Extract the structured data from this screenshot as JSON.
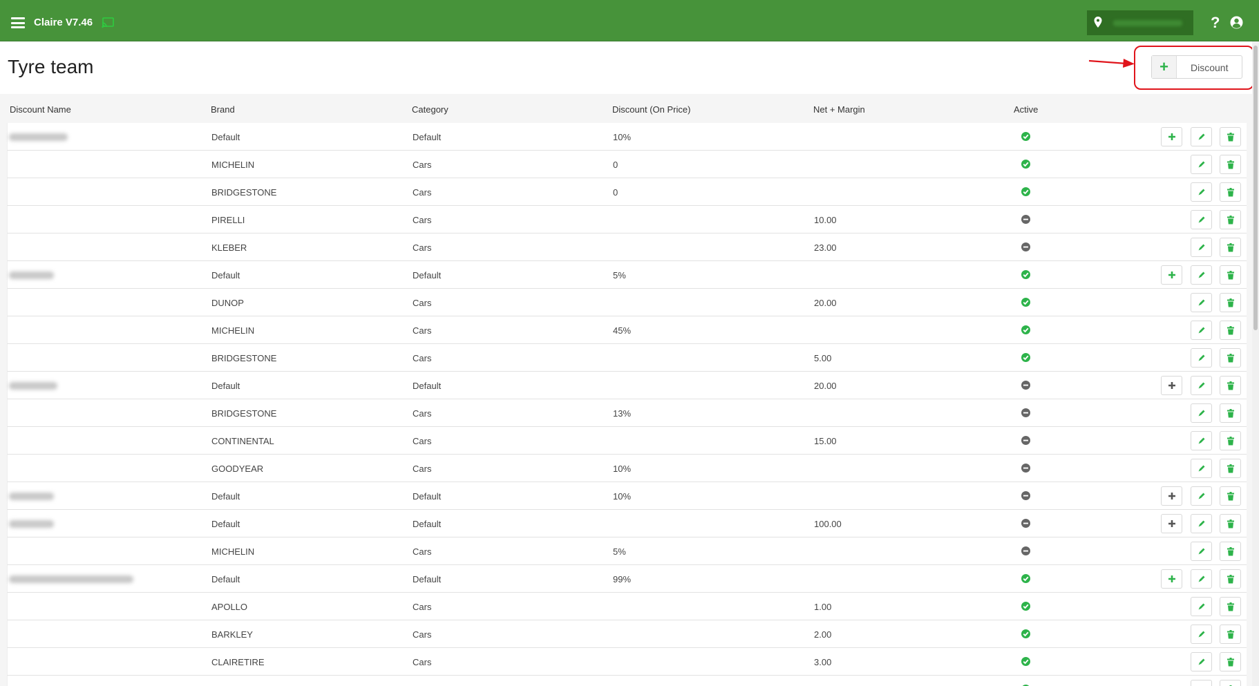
{
  "app": {
    "title": "Claire V7.46"
  },
  "page": {
    "title": "Tyre team",
    "add_button_label": "Discount"
  },
  "columns": [
    "Discount Name",
    "Brand",
    "Category",
    "Discount (On Price)",
    "Net + Margin",
    "Active"
  ],
  "colors": {
    "topbar": "#47933a",
    "accent_green": "#2db34a",
    "annotation_red": "#e0141b"
  },
  "rows": [
    {
      "name_blur": 85,
      "brand": "Default",
      "category": "Default",
      "discount": "10%",
      "net": "",
      "active": true,
      "add": "green"
    },
    {
      "name_blur": 0,
      "brand": "MICHELIN",
      "category": "Cars",
      "discount": "0",
      "net": "",
      "active": true,
      "add": ""
    },
    {
      "name_blur": 0,
      "brand": "BRIDGESTONE",
      "category": "Cars",
      "discount": "0",
      "net": "",
      "active": true,
      "add": ""
    },
    {
      "name_blur": 0,
      "brand": "PIRELLI",
      "category": "Cars",
      "discount": "",
      "net": "10.00",
      "active": false,
      "add": ""
    },
    {
      "name_blur": 0,
      "brand": "KLEBER",
      "category": "Cars",
      "discount": "",
      "net": "23.00",
      "active": false,
      "add": ""
    },
    {
      "name_blur": 65,
      "brand": "Default",
      "category": "Default",
      "discount": "5%",
      "net": "",
      "active": true,
      "add": "green"
    },
    {
      "name_blur": 0,
      "brand": "DUNOP",
      "category": "Cars",
      "discount": "",
      "net": "20.00",
      "active": true,
      "add": ""
    },
    {
      "name_blur": 0,
      "brand": "MICHELIN",
      "category": "Cars",
      "discount": "45%",
      "net": "",
      "active": true,
      "add": ""
    },
    {
      "name_blur": 0,
      "brand": "BRIDGESTONE",
      "category": "Cars",
      "discount": "",
      "net": "5.00",
      "active": true,
      "add": ""
    },
    {
      "name_blur": 70,
      "brand": "Default",
      "category": "Default",
      "discount": "",
      "net": "20.00",
      "active": false,
      "add": "gray"
    },
    {
      "name_blur": 0,
      "brand": "BRIDGESTONE",
      "category": "Cars",
      "discount": "13%",
      "net": "",
      "active": false,
      "add": ""
    },
    {
      "name_blur": 0,
      "brand": "CONTINENTAL",
      "category": "Cars",
      "discount": "",
      "net": "15.00",
      "active": false,
      "add": ""
    },
    {
      "name_blur": 0,
      "brand": "GOODYEAR",
      "category": "Cars",
      "discount": "10%",
      "net": "",
      "active": false,
      "add": ""
    },
    {
      "name_blur": 65,
      "brand": "Default",
      "category": "Default",
      "discount": "10%",
      "net": "",
      "active": false,
      "add": "gray"
    },
    {
      "name_blur": 65,
      "brand": "Default",
      "category": "Default",
      "discount": "",
      "net": "100.00",
      "active": false,
      "add": "gray"
    },
    {
      "name_blur": 0,
      "brand": "MICHELIN",
      "category": "Cars",
      "discount": "5%",
      "net": "",
      "active": false,
      "add": ""
    },
    {
      "name_blur": 180,
      "brand": "Default",
      "category": "Default",
      "discount": "99%",
      "net": "",
      "active": true,
      "add": "green"
    },
    {
      "name_blur": 0,
      "brand": "APOLLO",
      "category": "Cars",
      "discount": "",
      "net": "1.00",
      "active": true,
      "add": ""
    },
    {
      "name_blur": 0,
      "brand": "BARKLEY",
      "category": "Cars",
      "discount": "",
      "net": "2.00",
      "active": true,
      "add": ""
    },
    {
      "name_blur": 0,
      "brand": "CLAIRETIRE",
      "category": "Cars",
      "discount": "",
      "net": "3.00",
      "active": true,
      "add": ""
    },
    {
      "name_blur": 0,
      "brand": "",
      "category": "",
      "discount": "",
      "net": "",
      "active": true,
      "add": ""
    }
  ]
}
